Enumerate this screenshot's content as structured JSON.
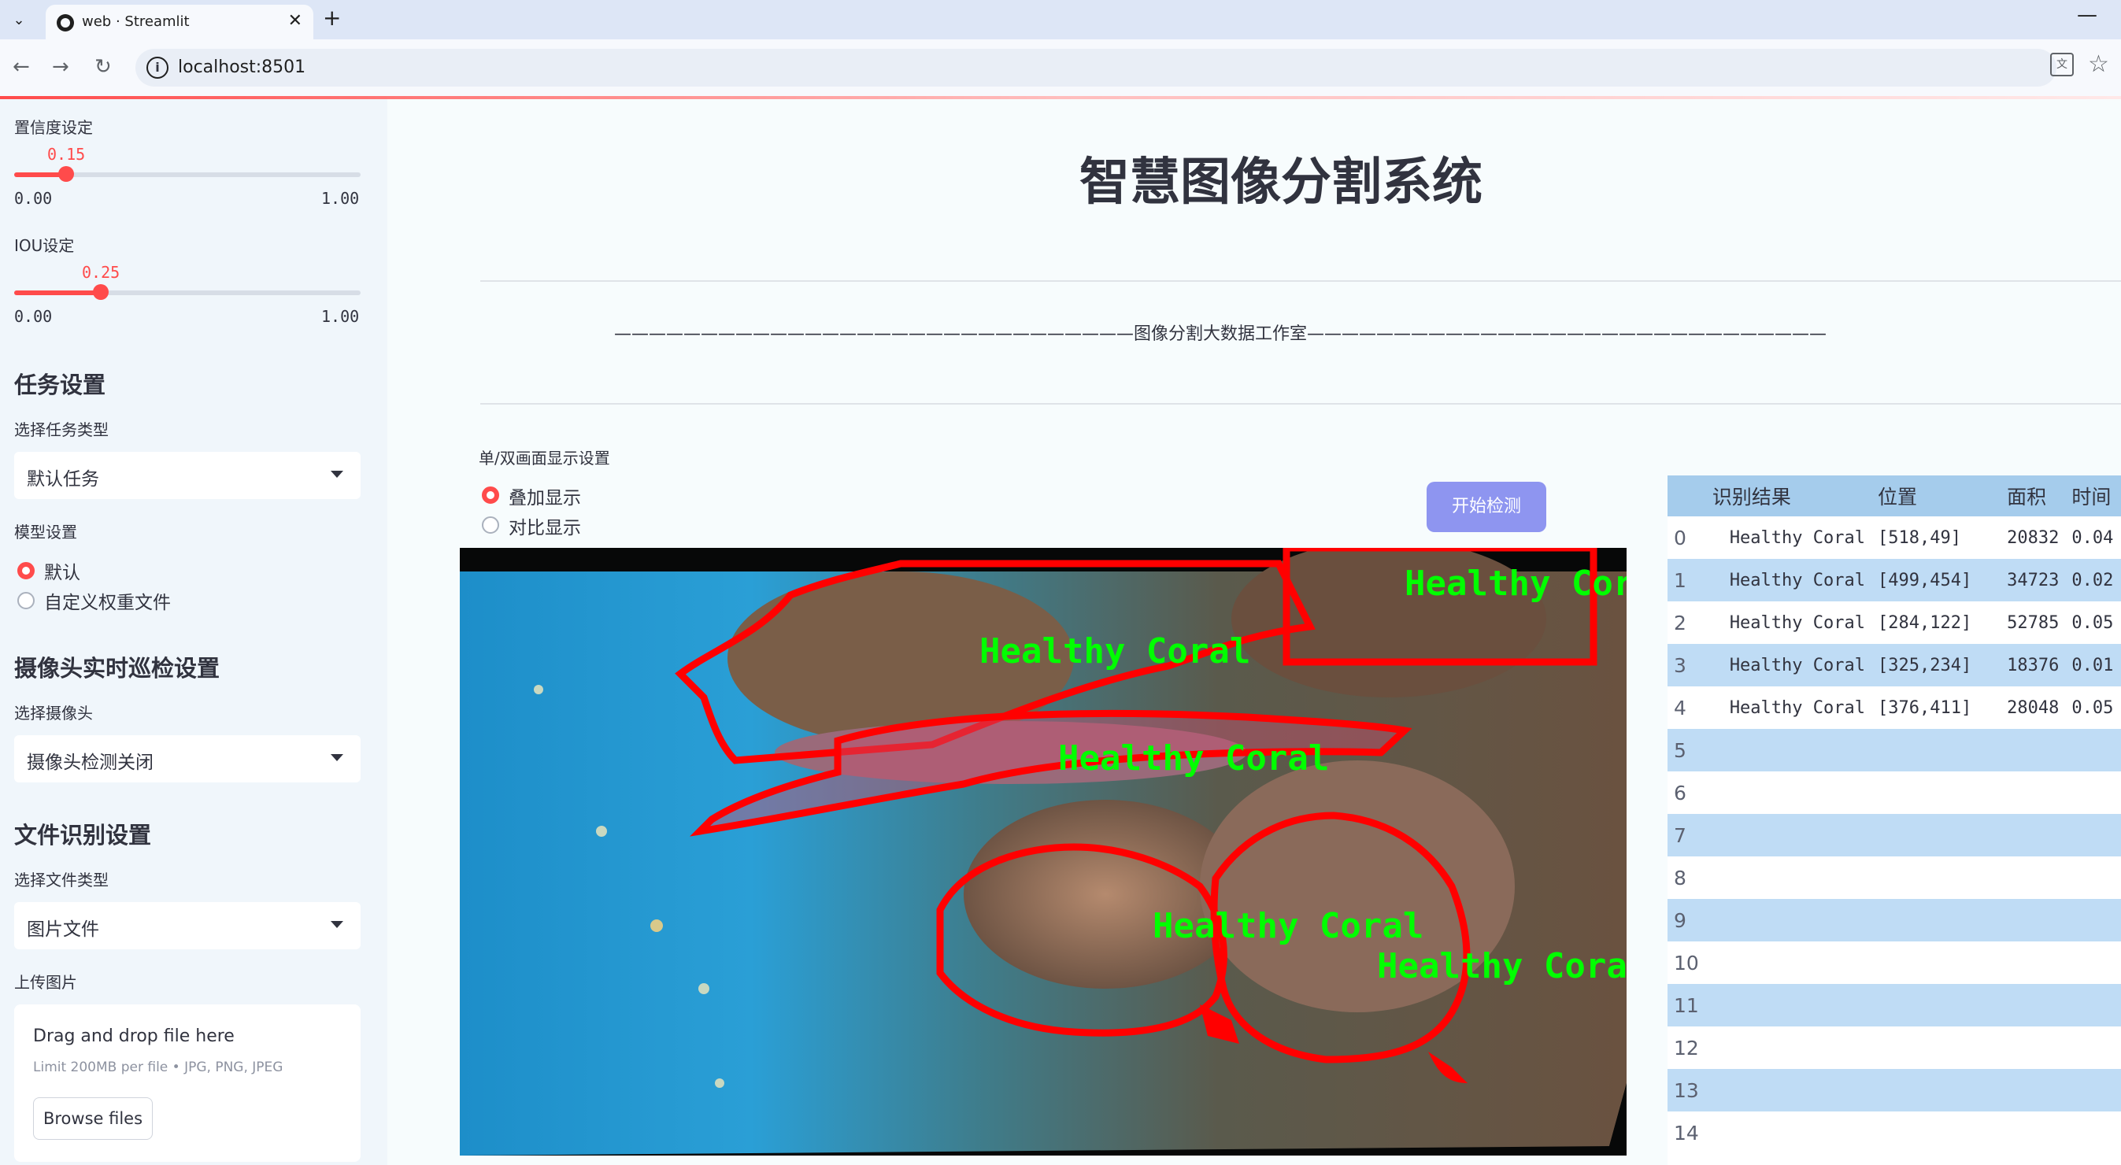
{
  "browser": {
    "tab_title": "web · Streamlit",
    "url": "localhost:8501",
    "icons": [
      "tab-dropdown-icon",
      "streamlit-favicon-icon",
      "close-tab-icon",
      "new-tab-icon",
      "minimize-icon",
      "back-icon",
      "forward-icon",
      "reload-icon",
      "site-info-icon",
      "translate-icon",
      "bookmark-star-icon"
    ]
  },
  "sidebar": {
    "confidence": {
      "label": "置信度设定",
      "value_text": "0.15",
      "value": 0.15,
      "min": "0.00",
      "max": "1.00"
    },
    "iou": {
      "label": "IOU设定",
      "value_text": "0.25",
      "value": 0.25,
      "min": "0.00",
      "max": "1.00"
    },
    "task_section": {
      "heading": "任务设置",
      "select_label": "选择任务类型",
      "select_value": "默认任务"
    },
    "model_section": {
      "label": "模型设置",
      "options": [
        "默认",
        "自定义权重文件"
      ],
      "selected": 0
    },
    "camera_section": {
      "heading": "摄像头实时巡检设置",
      "select_label": "选择摄像头",
      "select_value": "摄像头检测关闭"
    },
    "file_section": {
      "heading": "文件识别设置",
      "select_label": "选择文件类型",
      "select_value": "图片文件",
      "upload_label": "上传图片"
    },
    "uploader": {
      "title": "Drag and drop file here",
      "hint": "Limit 200MB per file • JPG, PNG, JPEG",
      "button": "Browse files"
    }
  },
  "main": {
    "title": "智慧图像分割系统",
    "divider_text": "——————————————————————————————图像分割大数据工作室——————————————————————————————",
    "display_mode": {
      "label": "单/双画面显示设置",
      "options": [
        "叠加显示",
        "对比显示"
      ],
      "selected": 0
    },
    "detect_button": "开始检测",
    "image_labels": [
      "Healthy Coral",
      "Healthy Coral",
      "Healthy Coral",
      "Healthy Coral",
      "Healthy Coral"
    ]
  },
  "results_table": {
    "columns": [
      "",
      "识别结果",
      "位置",
      "面积",
      "时间"
    ],
    "rows": [
      {
        "index": "0",
        "label": "Healthy Coral",
        "position": "[518,49]",
        "area": "20832",
        "time": "0.04"
      },
      {
        "index": "1",
        "label": "Healthy Coral",
        "position": "[499,454]",
        "area": "34723",
        "time": "0.02"
      },
      {
        "index": "2",
        "label": "Healthy Coral",
        "position": "[284,122]",
        "area": "52785",
        "time": "0.05"
      },
      {
        "index": "3",
        "label": "Healthy Coral",
        "position": "[325,234]",
        "area": "18376",
        "time": "0.01"
      },
      {
        "index": "4",
        "label": "Healthy Coral",
        "position": "[376,411]",
        "area": "28048",
        "time": "0.05"
      },
      {
        "index": "5",
        "label": "",
        "position": "",
        "area": "",
        "time": ""
      },
      {
        "index": "6",
        "label": "",
        "position": "",
        "area": "",
        "time": ""
      },
      {
        "index": "7",
        "label": "",
        "position": "",
        "area": "",
        "time": ""
      },
      {
        "index": "8",
        "label": "",
        "position": "",
        "area": "",
        "time": ""
      },
      {
        "index": "9",
        "label": "",
        "position": "",
        "area": "",
        "time": ""
      },
      {
        "index": "10",
        "label": "",
        "position": "",
        "area": "",
        "time": ""
      },
      {
        "index": "11",
        "label": "",
        "position": "",
        "area": "",
        "time": ""
      },
      {
        "index": "12",
        "label": "",
        "position": "",
        "area": "",
        "time": ""
      },
      {
        "index": "13",
        "label": "",
        "position": "",
        "area": "",
        "time": ""
      },
      {
        "index": "14",
        "label": "",
        "position": "",
        "area": "",
        "time": ""
      }
    ]
  },
  "colors": {
    "accent": "#ff4b4b",
    "button": "#8e95f0",
    "table_header": "#a5ccec",
    "table_stripe": "#bfdcf5",
    "mask_outline": "#ff0000",
    "mask_label": "#00ff00"
  }
}
